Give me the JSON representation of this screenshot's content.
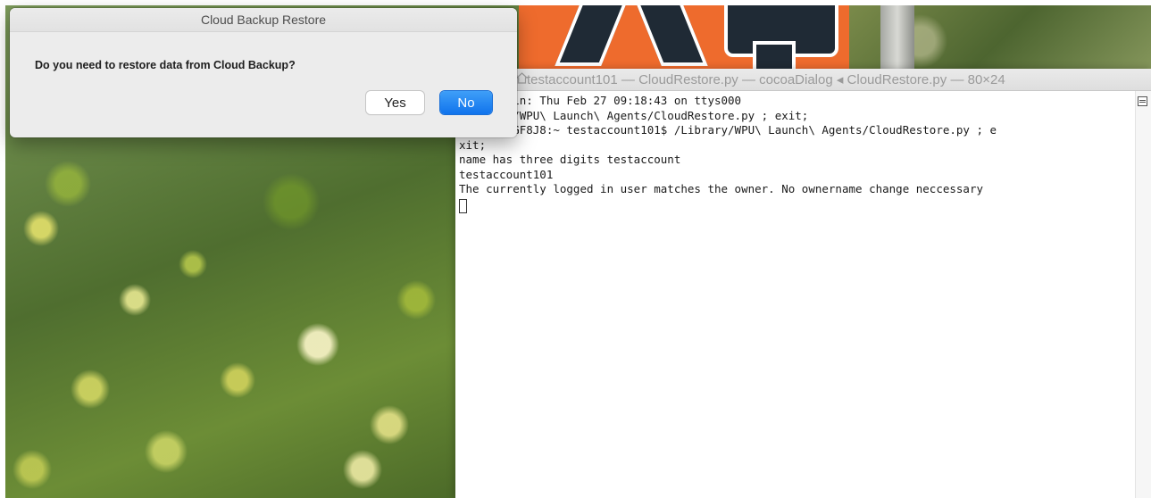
{
  "dialog": {
    "title": "Cloud Backup Restore",
    "message": "Do you need to restore data from Cloud Backup?",
    "yes_label": "Yes",
    "no_label": "No",
    "default_button_color": "#1a7cf0"
  },
  "terminal": {
    "title": "testaccount101 — CloudRestore.py — cocoaDialog ◂ CloudRestore.py — 80×24",
    "lines": [
      "Last login: Thu Feb 27 09:18:43 on ttys000",
      "/Library/WPU\\ Launch\\ Agents/CloudRestore.py ; exit;",
      "CH140-JDGF8J8:~ testaccount101$ /Library/WPU\\ Launch\\ Agents/CloudRestore.py ; e",
      "xit;",
      "name has three digits testaccount",
      "testaccount101",
      "The currently logged in user matches the owner. No ownername change neccessary"
    ]
  },
  "desktop": {
    "accent_orange": "#ee6b2d"
  }
}
